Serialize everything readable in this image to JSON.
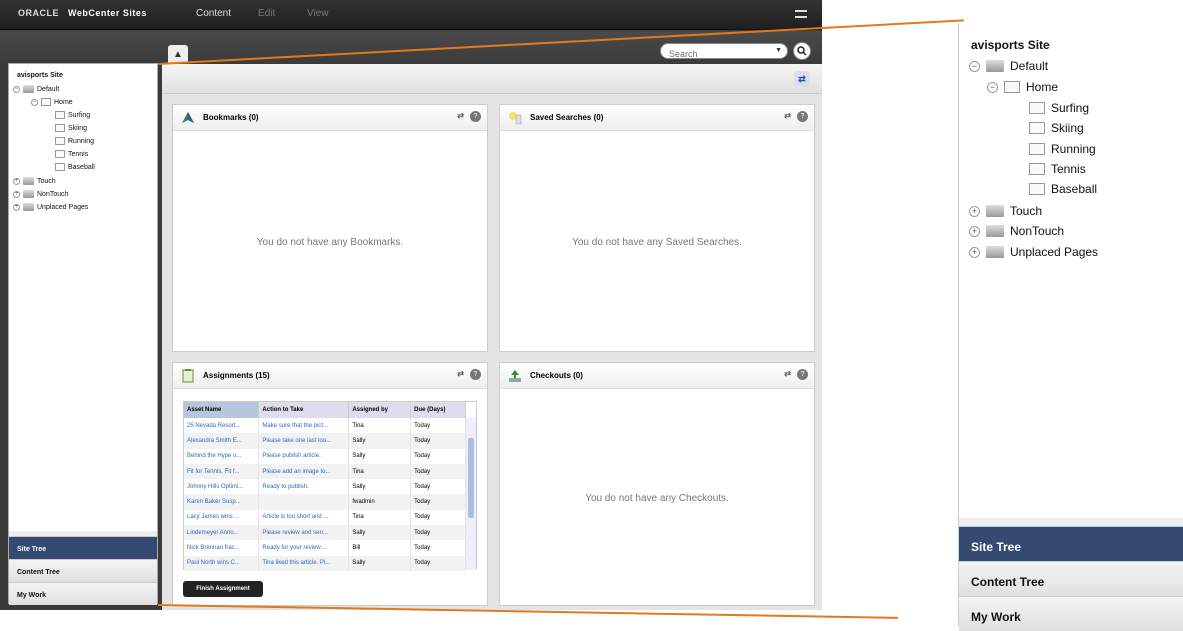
{
  "app": {
    "logo_text": "ORACLE",
    "product_name": "WebCenter Sites",
    "menu": [
      "Content",
      "Edit",
      "View"
    ]
  },
  "search": {
    "placeholder": "Search"
  },
  "site_tree": {
    "title": "avisports Site",
    "nodes": {
      "default": "Default",
      "home": "Home",
      "surfing": "Surfing",
      "skiing": "Skiing",
      "running": "Running",
      "tennis": "Tennis",
      "baseball": "Baseball",
      "touch": "Touch",
      "nontouch": "NonTouch",
      "unplaced": "Unplaced Pages"
    }
  },
  "accordion": [
    "Site Tree",
    "Content Tree",
    "My Work"
  ],
  "widgets": {
    "bookmarks": {
      "title": "Bookmarks (0)",
      "empty": "You do not have any Bookmarks."
    },
    "saved_searches": {
      "title": "Saved Searches (0)",
      "empty": "You do not have any Saved Searches."
    },
    "assignments": {
      "title": "Assignments (15)",
      "columns": [
        "Asset Name",
        "Action to Take",
        "Assigned by",
        "Due (Days)"
      ],
      "rows": [
        [
          "25 Nevada Resort...",
          "Make sure that the pict...",
          "Tina",
          "Today"
        ],
        [
          "Alexandra Smith E...",
          "Please take one last loo...",
          "Sally",
          "Today"
        ],
        [
          "Behind the Hype o...",
          "Please publish article.",
          "Sally",
          "Today"
        ],
        [
          "Fit for Tennis, Fit f...",
          "Please add an image to...",
          "Tina",
          "Today"
        ],
        [
          "Johnny Hills Optimi...",
          "Ready to publish.",
          "Sally",
          "Today"
        ],
        [
          "Karen Baker Susp...",
          "",
          "fwadmin",
          "Today"
        ],
        [
          "Lacy James wins ...",
          "Article is too short and ...",
          "Tina",
          "Today"
        ],
        [
          "Lindemeyer Anno...",
          "Please review and sen...",
          "Sally",
          "Today"
        ],
        [
          "Nick Brennan frac...",
          "Ready for your review....",
          "Bill",
          "Today"
        ],
        [
          "Paul North wins C...",
          "Tina liked this article. Pl...",
          "Sally",
          "Today"
        ]
      ],
      "button": "Finish Assignment"
    },
    "checkouts": {
      "title": "Checkouts (0)",
      "empty": "You do not have any Checkouts."
    }
  },
  "colors": {
    "callout": "#e07a1c",
    "active_tab": "#344a70",
    "link": "#2a6bbf"
  }
}
